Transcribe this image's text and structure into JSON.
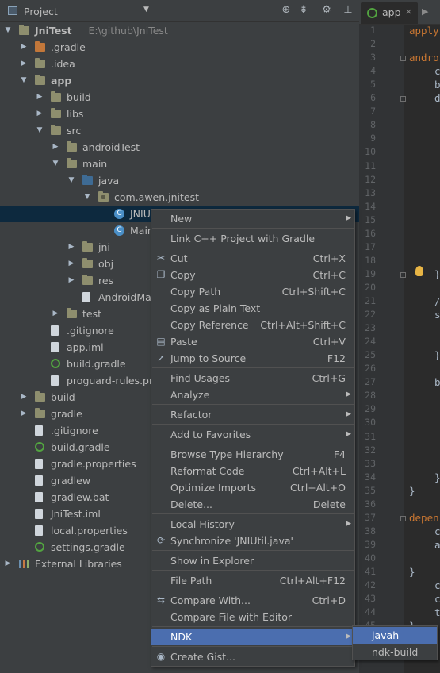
{
  "project_panel": {
    "title": "Project",
    "toolbar_icons": [
      "crosshair-icon",
      "collapse-all-icon",
      "gear-icon",
      "hide-icon"
    ]
  },
  "tree": [
    {
      "label": "JniTest",
      "path": "E:\\github\\JniTest",
      "icon": "module-icon",
      "arrow": "▼",
      "depth": 0,
      "bold": true
    },
    {
      "label": ".gradle",
      "icon": "folder-orange-icon",
      "arrow": "▶",
      "depth": 1
    },
    {
      "label": ".idea",
      "icon": "folder-icon",
      "arrow": "▶",
      "depth": 1
    },
    {
      "label": "app",
      "icon": "module-icon",
      "arrow": "▼",
      "depth": 1,
      "bold": true
    },
    {
      "label": "build",
      "icon": "folder-icon",
      "arrow": "▶",
      "depth": 2
    },
    {
      "label": "libs",
      "icon": "folder-icon",
      "arrow": "▶",
      "depth": 2
    },
    {
      "label": "src",
      "icon": "folder-icon",
      "arrow": "▼",
      "depth": 2
    },
    {
      "label": "androidTest",
      "icon": "folder-icon",
      "arrow": "▶",
      "depth": 3
    },
    {
      "label": "main",
      "icon": "folder-icon",
      "arrow": "▼",
      "depth": 3
    },
    {
      "label": "java",
      "icon": "folder-blue-icon",
      "arrow": "▼",
      "depth": 4
    },
    {
      "label": "com.awen.jnitest",
      "icon": "package-icon",
      "arrow": "▼",
      "depth": 5
    },
    {
      "label": "JNIUtil",
      "icon": "class-icon",
      "arrow": "",
      "depth": 6,
      "selected": true
    },
    {
      "label": "MainActivity",
      "icon": "class-icon",
      "arrow": "",
      "depth": 6
    },
    {
      "label": "jni",
      "icon": "folder-icon",
      "arrow": "▶",
      "depth": 4
    },
    {
      "label": "obj",
      "icon": "folder-icon",
      "arrow": "▶",
      "depth": 4
    },
    {
      "label": "res",
      "icon": "folder-icon",
      "arrow": "▶",
      "depth": 4
    },
    {
      "label": "AndroidManifest.xml",
      "icon": "file-icon",
      "arrow": "",
      "depth": 4
    },
    {
      "label": "test",
      "icon": "folder-icon",
      "arrow": "▶",
      "depth": 3
    },
    {
      "label": ".gitignore",
      "icon": "file-icon",
      "arrow": "",
      "depth": 2
    },
    {
      "label": "app.iml",
      "icon": "file-icon",
      "arrow": "",
      "depth": 2
    },
    {
      "label": "build.gradle",
      "icon": "gradle-icon",
      "arrow": "",
      "depth": 2
    },
    {
      "label": "proguard-rules.pro",
      "icon": "file-icon",
      "arrow": "",
      "depth": 2
    },
    {
      "label": "build",
      "icon": "folder-icon",
      "arrow": "▶",
      "depth": 1
    },
    {
      "label": "gradle",
      "icon": "folder-icon",
      "arrow": "▶",
      "depth": 1
    },
    {
      "label": ".gitignore",
      "icon": "file-icon",
      "arrow": "",
      "depth": 1
    },
    {
      "label": "build.gradle",
      "icon": "gradle-icon",
      "arrow": "",
      "depth": 1
    },
    {
      "label": "gradle.properties",
      "icon": "file-icon",
      "arrow": "",
      "depth": 1
    },
    {
      "label": "gradlew",
      "icon": "file-icon",
      "arrow": "",
      "depth": 1
    },
    {
      "label": "gradlew.bat",
      "icon": "file-icon",
      "arrow": "",
      "depth": 1
    },
    {
      "label": "JniTest.iml",
      "icon": "file-icon",
      "arrow": "",
      "depth": 1
    },
    {
      "label": "local.properties",
      "icon": "file-icon",
      "arrow": "",
      "depth": 1
    },
    {
      "label": "settings.gradle",
      "icon": "gradle-icon",
      "arrow": "",
      "depth": 1
    },
    {
      "label": "External Libraries",
      "icon": "library-icon",
      "arrow": "▶",
      "depth": 0
    }
  ],
  "editor": {
    "tab": {
      "label": "app",
      "close": "×",
      "more": "▶"
    },
    "line_numbers": [
      "1",
      "2",
      "3",
      "4",
      "5",
      "6",
      "7",
      "8",
      "9",
      "10",
      "11",
      "12",
      "13",
      "14",
      "15",
      "16",
      "17",
      "18",
      "19",
      "20",
      "21",
      "22",
      "23",
      "24",
      "25",
      "26",
      "27",
      "28",
      "29",
      "30",
      "31",
      "32",
      "33",
      "34",
      "35",
      "36",
      "37",
      "38",
      "39",
      "40",
      "41",
      "42",
      "43",
      "44",
      "45"
    ],
    "code_lines": [
      "apply",
      "",
      "andro",
      "c",
      "b",
      "d",
      "",
      "",
      "",
      "",
      "",
      "",
      "",
      "",
      "",
      "",
      "",
      "",
      "}",
      "",
      "/",
      "s",
      "",
      "",
      "}",
      "",
      "b",
      "",
      "",
      "",
      "",
      "",
      "",
      "}",
      "}",
      "",
      "depen",
      "c",
      "a",
      "",
      "}",
      "c",
      "c",
      "t",
      "}"
    ]
  },
  "context_menu": {
    "items": [
      {
        "label": "New",
        "shortcut": "",
        "submenu": true,
        "icon": ""
      },
      {
        "separator": true
      },
      {
        "label": "Link C++ Project with Gradle",
        "shortcut": "",
        "submenu": false,
        "icon": ""
      },
      {
        "separator": true
      },
      {
        "label": "Cut",
        "shortcut": "Ctrl+X",
        "submenu": false,
        "icon": "scissors-icon"
      },
      {
        "label": "Copy",
        "shortcut": "Ctrl+C",
        "submenu": false,
        "icon": "copy-icon"
      },
      {
        "label": "Copy Path",
        "shortcut": "Ctrl+Shift+C",
        "submenu": false,
        "icon": ""
      },
      {
        "label": "Copy as Plain Text",
        "shortcut": "",
        "submenu": false,
        "icon": ""
      },
      {
        "label": "Copy Reference",
        "shortcut": "Ctrl+Alt+Shift+C",
        "submenu": false,
        "icon": ""
      },
      {
        "label": "Paste",
        "shortcut": "Ctrl+V",
        "submenu": false,
        "icon": "paste-icon"
      },
      {
        "label": "Jump to Source",
        "shortcut": "F12",
        "submenu": false,
        "icon": "jump-to-source-icon"
      },
      {
        "separator": true
      },
      {
        "label": "Find Usages",
        "shortcut": "Ctrl+G",
        "submenu": false,
        "icon": ""
      },
      {
        "label": "Analyze",
        "shortcut": "",
        "submenu": true,
        "icon": ""
      },
      {
        "separator": true
      },
      {
        "label": "Refactor",
        "shortcut": "",
        "submenu": true,
        "icon": ""
      },
      {
        "separator": true
      },
      {
        "label": "Add to Favorites",
        "shortcut": "",
        "submenu": true,
        "icon": ""
      },
      {
        "separator": true
      },
      {
        "label": "Browse Type Hierarchy",
        "shortcut": "F4",
        "submenu": false,
        "icon": ""
      },
      {
        "label": "Reformat Code",
        "shortcut": "Ctrl+Alt+L",
        "submenu": false,
        "icon": ""
      },
      {
        "label": "Optimize Imports",
        "shortcut": "Ctrl+Alt+O",
        "submenu": false,
        "icon": ""
      },
      {
        "label": "Delete...",
        "shortcut": "Delete",
        "submenu": false,
        "icon": ""
      },
      {
        "separator": true
      },
      {
        "label": "Local History",
        "shortcut": "",
        "submenu": true,
        "icon": ""
      },
      {
        "label": "Synchronize 'JNIUtil.java'",
        "shortcut": "",
        "submenu": false,
        "icon": "sync-icon"
      },
      {
        "separator": true
      },
      {
        "label": "Show in Explorer",
        "shortcut": "",
        "submenu": false,
        "icon": ""
      },
      {
        "separator": true
      },
      {
        "label": "File Path",
        "shortcut": "Ctrl+Alt+F12",
        "submenu": false,
        "icon": ""
      },
      {
        "separator": true
      },
      {
        "label": "Compare With...",
        "shortcut": "Ctrl+D",
        "submenu": false,
        "icon": "compare-icon"
      },
      {
        "label": "Compare File with Editor",
        "shortcut": "",
        "submenu": false,
        "icon": ""
      },
      {
        "separator": true
      },
      {
        "label": "NDK",
        "shortcut": "",
        "submenu": true,
        "icon": "",
        "highlighted": true
      },
      {
        "separator": true
      },
      {
        "label": "Create Gist...",
        "shortcut": "",
        "submenu": false,
        "icon": "github-icon"
      }
    ]
  },
  "ndk_submenu": {
    "items": [
      {
        "label": "javah",
        "highlighted": true
      },
      {
        "label": "ndk-build",
        "highlighted": false
      }
    ]
  },
  "colors": {
    "panel_bg": "#3c3f41",
    "editor_bg": "#2b2b2b",
    "selection": "#0d293e",
    "menu_highlight": "#4b6eaf",
    "keyword": "#cc7832"
  }
}
